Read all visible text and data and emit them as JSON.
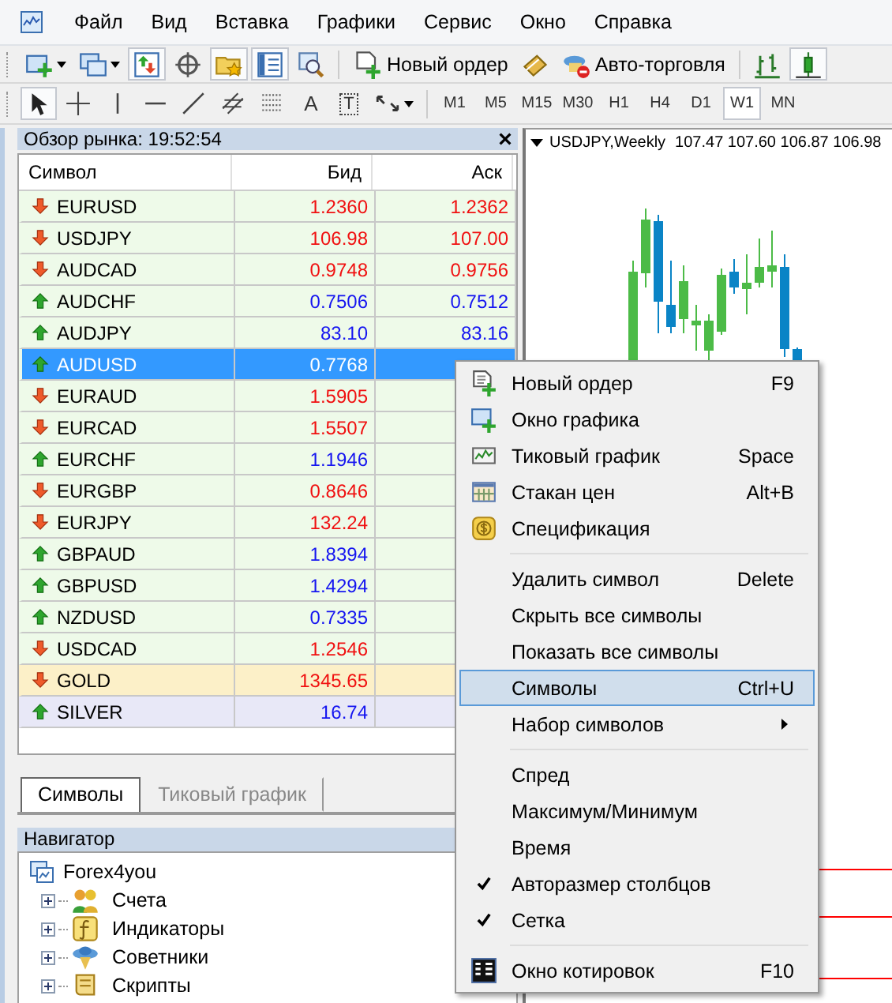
{
  "menu_bar": {
    "items": [
      "Файл",
      "Вид",
      "Вставка",
      "Графики",
      "Сервис",
      "Окно",
      "Справка"
    ]
  },
  "toolbar": {
    "tools": [
      {
        "pressed": false
      },
      {
        "pressed": false
      },
      {
        "pressed": true
      },
      {
        "pressed": false
      },
      {
        "pressed": true
      },
      {
        "pressed": true
      },
      {
        "pressed": false
      }
    ],
    "order_button": "Новый ордер",
    "autotrading_button": "Авто-торговля",
    "chart_types": [
      {
        "selected": false
      },
      {
        "selected": true
      }
    ]
  },
  "drawing_bar": {
    "tools": [
      {
        "pressed": true
      },
      {
        "pressed": false
      },
      {
        "pressed": false
      },
      {
        "pressed": false
      },
      {
        "pressed": false
      },
      {
        "pressed": false
      },
      {
        "pressed": false
      },
      {
        "pressed": false,
        "label": "A"
      },
      {
        "pressed": false,
        "label": "T"
      },
      {
        "pressed": false
      }
    ],
    "timeframes": [
      {
        "label": "M1",
        "selected": false
      },
      {
        "label": "M5",
        "selected": false
      },
      {
        "label": "M15",
        "selected": false
      },
      {
        "label": "M30",
        "selected": false
      },
      {
        "label": "H1",
        "selected": false
      },
      {
        "label": "H4",
        "selected": false
      },
      {
        "label": "D1",
        "selected": false
      },
      {
        "label": "W1",
        "selected": true
      },
      {
        "label": "MN",
        "selected": false
      }
    ]
  },
  "market_watch": {
    "title": "Обзор рынка: 19:52:54",
    "columns": [
      "Символ",
      "Бид",
      "Аск"
    ],
    "rows": [
      {
        "symbol": "EURUSD",
        "rising": false,
        "bid": "1.2360",
        "ask": "1.2362",
        "color": "#eefae9",
        "selected": false
      },
      {
        "symbol": "USDJPY",
        "rising": false,
        "bid": "106.98",
        "ask": "107.00",
        "color": "#eefae9",
        "selected": false
      },
      {
        "symbol": "AUDCAD",
        "rising": false,
        "bid": "0.9748",
        "ask": "0.9756",
        "color": "#eefae9",
        "selected": false
      },
      {
        "symbol": "AUDCHF",
        "rising": true,
        "bid": "0.7506",
        "ask": "0.7512",
        "color": "#eefae9",
        "selected": false
      },
      {
        "symbol": "AUDJPY",
        "rising": true,
        "bid": "83.10",
        "ask": "83.16",
        "color": "#eefae9",
        "selected": false
      },
      {
        "symbol": "AUDUSD",
        "rising": true,
        "bid": "0.7768",
        "color": "#eefae9",
        "selected": true
      },
      {
        "symbol": "EURAUD",
        "rising": false,
        "bid": "1.5905",
        "color": "#eefae9",
        "selected": false
      },
      {
        "symbol": "EURCAD",
        "rising": false,
        "bid": "1.5507",
        "color": "#eefae9",
        "selected": false
      },
      {
        "symbol": "EURCHF",
        "rising": true,
        "bid": "1.1946",
        "color": "#eefae9",
        "selected": false
      },
      {
        "symbol": "EURGBP",
        "rising": false,
        "bid": "0.8646",
        "color": "#eefae9",
        "selected": false
      },
      {
        "symbol": "EURJPY",
        "rising": false,
        "bid": "132.24",
        "color": "#eefae9",
        "selected": false
      },
      {
        "symbol": "GBPAUD",
        "rising": true,
        "bid": "1.8394",
        "color": "#eefae9",
        "selected": false
      },
      {
        "symbol": "GBPUSD",
        "rising": true,
        "bid": "1.4294",
        "color": "#eefae9",
        "selected": false
      },
      {
        "symbol": "NZDUSD",
        "rising": true,
        "bid": "0.7335",
        "color": "#eefae9",
        "selected": false
      },
      {
        "symbol": "USDCAD",
        "rising": false,
        "bid": "1.2546",
        "color": "#eefae9",
        "selected": false
      },
      {
        "symbol": "GOLD",
        "rising": false,
        "bid": "1345.65",
        "color": "#fcf0c8",
        "selected": false
      },
      {
        "symbol": "SILVER",
        "rising": true,
        "bid": "16.74",
        "color": "#e8e8f7",
        "selected": false
      }
    ],
    "tabs": [
      {
        "label": "Символы",
        "selected": true
      },
      {
        "label": "Тиковый график",
        "selected": false
      }
    ]
  },
  "navigator": {
    "title": "Навигатор",
    "tree": [
      {
        "label": "Forex4you",
        "expanded": true,
        "children": [
          {
            "label": "Счета",
            "expanded": false
          },
          {
            "label": "Индикаторы",
            "expanded": false
          },
          {
            "label": "Советники",
            "expanded": false
          },
          {
            "label": "Скрипты",
            "expanded": false
          }
        ]
      }
    ]
  },
  "chart": {
    "symbol": "USDJPY,Weekly",
    "ohlc": "107.47 107.60 106.87 106.98"
  },
  "context_menu": {
    "groups": [
      [
        {
          "label": "Новый ордер",
          "shortcut": "F9",
          "selected": false
        },
        {
          "label": "Окно графика",
          "selected": false
        },
        {
          "label": "Тиковый график",
          "shortcut": "Space",
          "selected": false
        },
        {
          "label": "Стакан цен",
          "shortcut": "Alt+B",
          "selected": false
        },
        {
          "label": "Спецификация",
          "selected": false
        }
      ],
      [
        {
          "label": "Удалить символ",
          "shortcut": "Delete",
          "selected": false
        },
        {
          "label": "Скрыть все символы",
          "selected": false
        },
        {
          "label": "Показать все символы",
          "selected": false
        },
        {
          "label": "Символы",
          "shortcut": "Ctrl+U",
          "selected": true
        },
        {
          "label": "Набор символов",
          "submenu": true,
          "selected": false
        }
      ],
      [
        {
          "label": "Спред",
          "checked": false,
          "selected": false
        },
        {
          "label": "Максимум/Минимум",
          "checked": false,
          "selected": false
        },
        {
          "label": "Время",
          "checked": false,
          "selected": false
        },
        {
          "label": "Авторазмер столбцов",
          "checked": true,
          "selected": false
        },
        {
          "label": "Сетка",
          "checked": true,
          "selected": false
        }
      ],
      [
        {
          "label": "Окно котировок",
          "shortcut": "F10",
          "selected": false
        }
      ]
    ]
  }
}
